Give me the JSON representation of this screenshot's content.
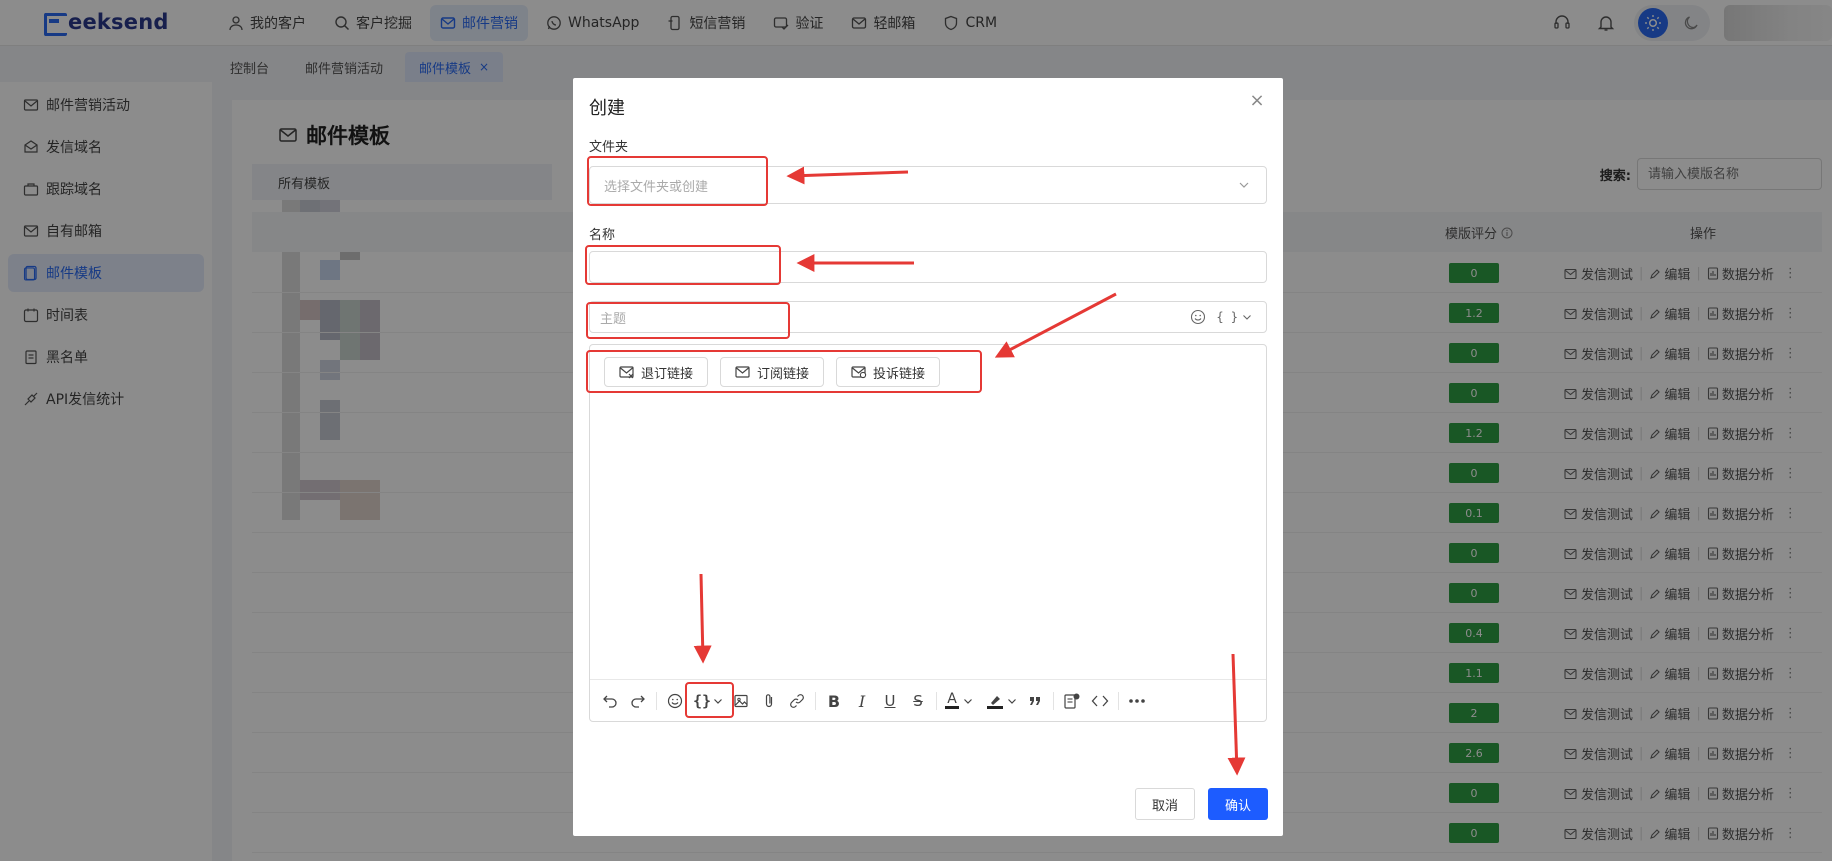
{
  "brand": {
    "logo_text": "eeksend"
  },
  "nav": {
    "items": [
      {
        "label": "我的客户",
        "icon": "user-icon"
      },
      {
        "label": "客户挖掘",
        "icon": "search-icon"
      },
      {
        "label": "邮件营销",
        "icon": "mail-icon"
      },
      {
        "label": "WhatsApp",
        "icon": "whatsapp-icon"
      },
      {
        "label": "短信营销",
        "icon": "sms-icon"
      },
      {
        "label": "验证",
        "icon": "verify-icon"
      },
      {
        "label": "轻邮箱",
        "icon": "light-mail-icon"
      },
      {
        "label": "CRM",
        "icon": "crm-icon"
      }
    ]
  },
  "tabs": [
    {
      "label": "控制台"
    },
    {
      "label": "邮件营销活动"
    },
    {
      "label": "邮件模板",
      "close": "×"
    }
  ],
  "sidebar": {
    "items": [
      {
        "label": "邮件营销活动"
      },
      {
        "label": "发信域名"
      },
      {
        "label": "跟踪域名"
      },
      {
        "label": "自有邮箱"
      },
      {
        "label": "邮件模板"
      },
      {
        "label": "时间表"
      },
      {
        "label": "黑名单"
      },
      {
        "label": "API发信统计"
      }
    ]
  },
  "main": {
    "title": "邮件模板",
    "folder_all": "所有模板",
    "search_label": "搜索:",
    "search_placeholder": "请输入模版名称",
    "col_score": "模版评分",
    "col_ops": "操作",
    "op_test": "发信测试",
    "op_edit": "编辑",
    "op_analysis": "数据分析",
    "more": "⋮",
    "scores": [
      "0",
      "1.2",
      "0",
      "0",
      "1.2",
      "0",
      "0.1",
      "0",
      "0",
      "0.4",
      "1.1",
      "2",
      "2.6",
      "0",
      "0"
    ]
  },
  "modal": {
    "title": "创建",
    "close": "×",
    "folder_label": "文件夹",
    "folder_placeholder": "选择文件夹或创建",
    "name_label": "名称",
    "subject_placeholder": "主题",
    "subject_var": "{ }",
    "link_buttons": [
      "退订链接",
      "订阅链接",
      "投诉链接"
    ],
    "cancel": "取消",
    "confirm": "确认"
  },
  "colors": {
    "accent": "#2a6bf2",
    "confirm": "#1d5cff",
    "score_green": "#2f9e44",
    "annotation_red": "#e53935"
  }
}
